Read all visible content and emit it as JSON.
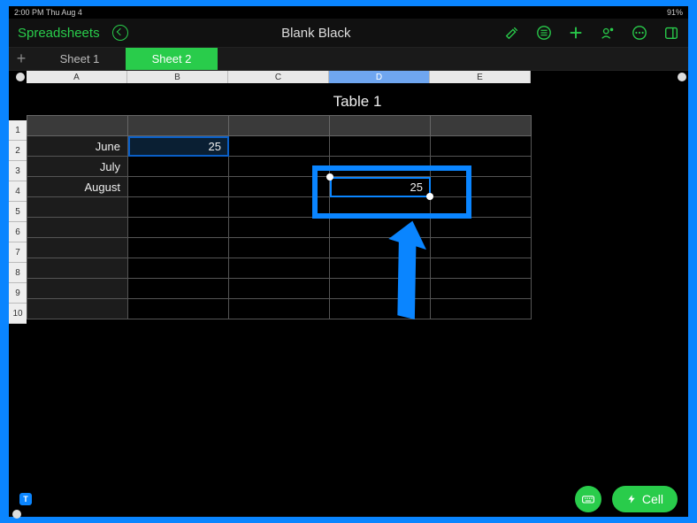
{
  "status": {
    "left": "2:00 PM   Thu Aug 4",
    "right": "91%"
  },
  "toolbar": {
    "back": "Spreadsheets",
    "title": "Blank Black"
  },
  "tabs": [
    "Sheet 1",
    "Sheet 2"
  ],
  "active_tab": 1,
  "columns": [
    "A",
    "B",
    "C",
    "D",
    "E"
  ],
  "selected_column": 3,
  "table": {
    "title": "Table 1",
    "rows": [
      {
        "label": "June",
        "b": "25",
        "c": "",
        "d": "",
        "e": ""
      },
      {
        "label": "July",
        "b": "",
        "c": "",
        "d": "",
        "e": ""
      },
      {
        "label": "August",
        "b": "",
        "c": "",
        "d": "25",
        "e": ""
      },
      {
        "label": "",
        "b": "",
        "c": "",
        "d": "",
        "e": ""
      },
      {
        "label": "",
        "b": "",
        "c": "",
        "d": "",
        "e": ""
      },
      {
        "label": "",
        "b": "",
        "c": "",
        "d": "",
        "e": ""
      },
      {
        "label": "",
        "b": "",
        "c": "",
        "d": "",
        "e": ""
      },
      {
        "label": "",
        "b": "",
        "c": "",
        "d": "",
        "e": ""
      },
      {
        "label": "",
        "b": "",
        "c": "",
        "d": "",
        "e": ""
      }
    ]
  },
  "bottom": {
    "badge": "T",
    "hint": "",
    "cell_label": "Cell"
  },
  "row_numbers": [
    "1",
    "2",
    "3",
    "4",
    "5",
    "6",
    "7",
    "8",
    "9",
    "10"
  ],
  "colors": {
    "accent": "#29cc4b",
    "select": "#0a85ff"
  }
}
